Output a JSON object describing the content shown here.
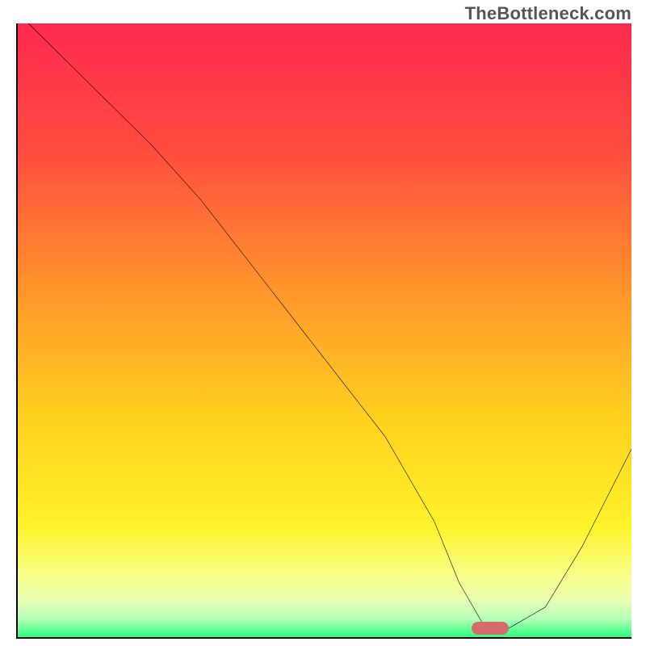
{
  "watermark": "TheBottleneck.com",
  "chart_data": {
    "type": "line",
    "title": "",
    "xlabel": "",
    "ylabel": "",
    "xlim": [
      0,
      100
    ],
    "ylim": [
      0,
      100
    ],
    "grid": false,
    "series": [
      {
        "name": "bottleneck-curve",
        "x": [
          2,
          10,
          22,
          30,
          40,
          50,
          60,
          68,
          72,
          76,
          80,
          86,
          92,
          100
        ],
        "y": [
          100,
          92,
          80,
          71,
          58,
          45,
          32,
          18,
          8,
          1,
          0.5,
          4,
          14,
          30
        ]
      }
    ],
    "marker": {
      "x": 77,
      "y": 0.5
    },
    "gradient_stops": [
      {
        "offset": 0,
        "color": "#ff2a4f"
      },
      {
        "offset": 0.2,
        "color": "#ff4a3f"
      },
      {
        "offset": 0.45,
        "color": "#ff9a2a"
      },
      {
        "offset": 0.65,
        "color": "#ffd21f"
      },
      {
        "offset": 0.82,
        "color": "#fff22a"
      },
      {
        "offset": 0.9,
        "color": "#f7ff8a"
      },
      {
        "offset": 0.94,
        "color": "#e6ffb0"
      },
      {
        "offset": 0.97,
        "color": "#b6ffba"
      },
      {
        "offset": 1.0,
        "color": "#2bff7a"
      }
    ]
  }
}
